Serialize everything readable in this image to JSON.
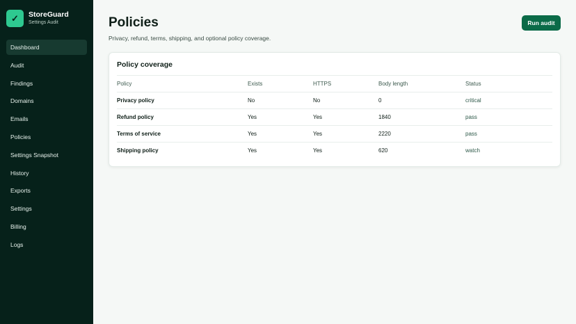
{
  "brand": {
    "logo_icon": "check-icon",
    "logo_glyph": "✓",
    "name": "StoreGuard",
    "subtitle": "Settings Audit",
    "accent_color": "#2ec990"
  },
  "sidebar": {
    "items": [
      {
        "label": "Dashboard",
        "active": true
      },
      {
        "label": "Audit",
        "active": false
      },
      {
        "label": "Findings",
        "active": false
      },
      {
        "label": "Domains",
        "active": false
      },
      {
        "label": "Emails",
        "active": false
      },
      {
        "label": "Policies",
        "active": false
      },
      {
        "label": "Settings Snapshot",
        "active": false
      },
      {
        "label": "History",
        "active": false
      },
      {
        "label": "Exports",
        "active": false
      },
      {
        "label": "Settings",
        "active": false
      },
      {
        "label": "Billing",
        "active": false
      },
      {
        "label": "Logs",
        "active": false
      }
    ]
  },
  "header": {
    "title": "Policies",
    "subtitle": "Privacy, refund, terms, shipping, and optional policy coverage.",
    "run_button_label": "Run audit",
    "button_color": "#0b6b48"
  },
  "card": {
    "title": "Policy coverage",
    "columns": [
      "Policy",
      "Exists",
      "HTTPS",
      "Body length",
      "Status"
    ],
    "rows": [
      {
        "policy": "Privacy policy",
        "exists": "No",
        "https": "No",
        "body_length": "0",
        "status": "critical"
      },
      {
        "policy": "Refund policy",
        "exists": "Yes",
        "https": "Yes",
        "body_length": "1840",
        "status": "pass"
      },
      {
        "policy": "Terms of service",
        "exists": "Yes",
        "https": "Yes",
        "body_length": "2220",
        "status": "pass"
      },
      {
        "policy": "Shipping policy",
        "exists": "Yes",
        "https": "Yes",
        "body_length": "620",
        "status": "watch"
      }
    ]
  }
}
